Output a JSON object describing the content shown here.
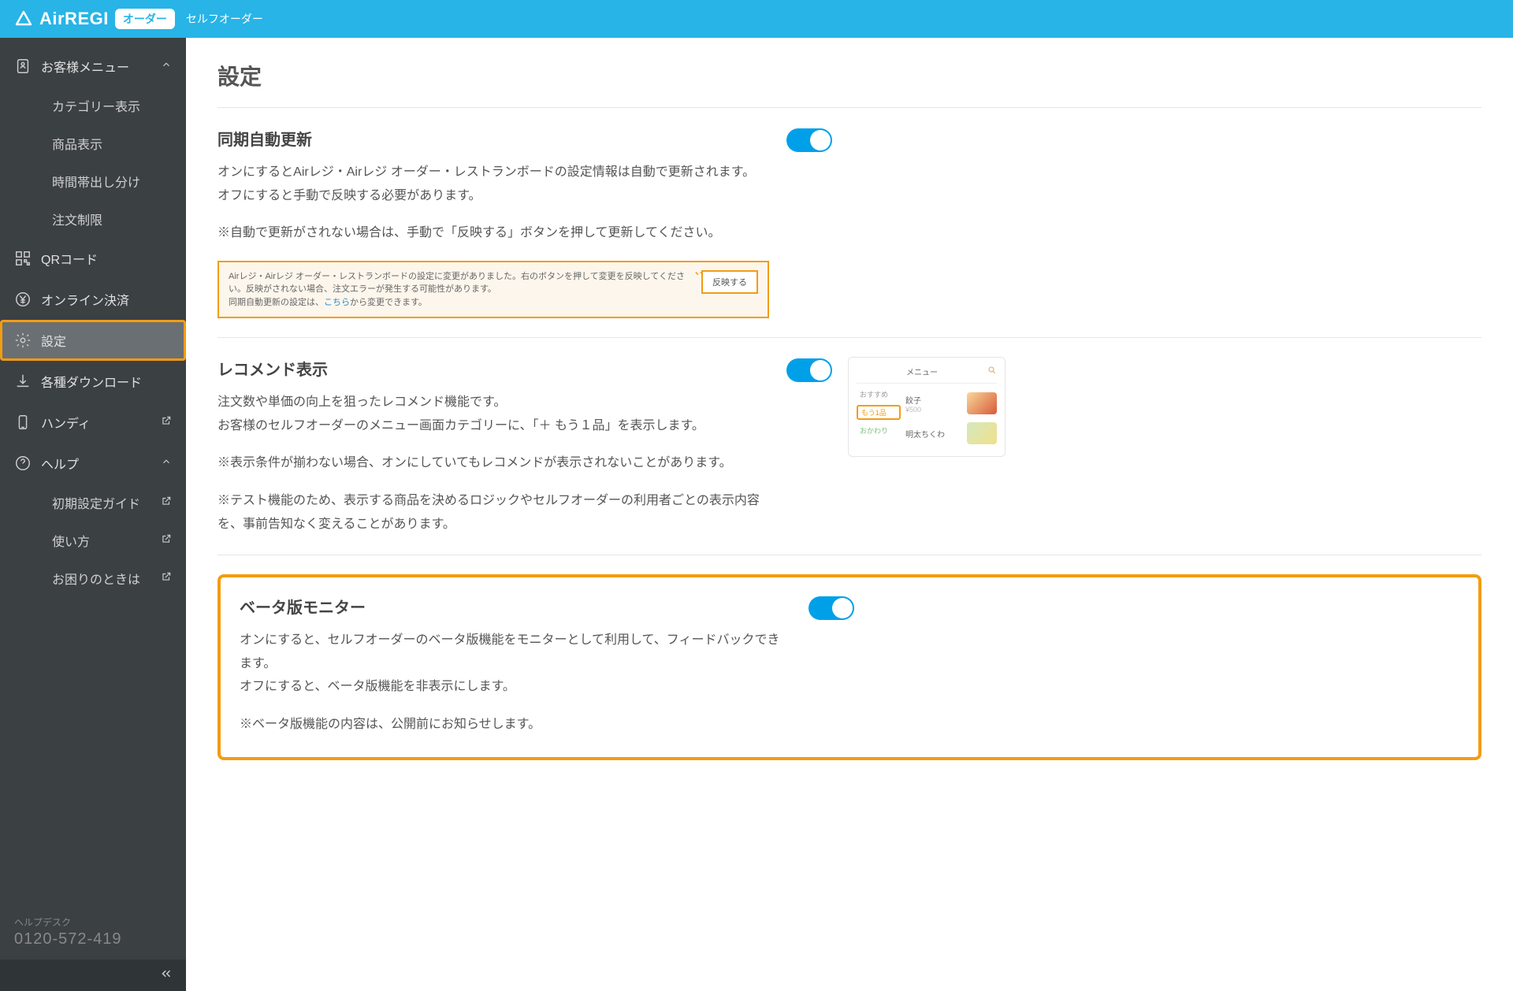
{
  "header": {
    "logo_text": "AirREGI",
    "logo_badge": "オーダー",
    "logo_sub": "セルフオーダー"
  },
  "sidebar": {
    "customer_menu_label": "お客様メニュー",
    "customer_sub": [
      "カテゴリー表示",
      "商品表示",
      "時間帯出し分け",
      "注文制限"
    ],
    "qr_label": "QRコード",
    "online_pay_label": "オンライン決済",
    "settings_label": "設定",
    "downloads_label": "各種ダウンロード",
    "handy_label": "ハンディ",
    "help_label": "ヘルプ",
    "help_sub": [
      "初期設定ガイド",
      "使い方",
      "お困りのときは"
    ],
    "helpdesk_label": "ヘルプデスク",
    "helpdesk_number": "0120-572-419"
  },
  "page": {
    "title": "設定"
  },
  "sync": {
    "title": "同期自動更新",
    "desc": "オンにするとAirレジ・Airレジ オーダー・レストランボードの設定情報は自動で更新されます。\nオフにすると手動で反映する必要があります。",
    "note": "※自動で更新がされない場合は、手動で「反映する」ボタンを押して更新してください。",
    "info_line1": "Airレジ・Airレジ オーダー・レストランボードの設定に変更がありました。右のボタンを押して変更を反映してください。反映がされない場合、注文エラーが発生する可能性があります。",
    "info_line2_pre": "同期自動更新の設定は、",
    "info_link": "こちら",
    "info_line2_post": "から変更できます。",
    "info_button": "反映する"
  },
  "recommend": {
    "title": "レコメンド表示",
    "desc": "注文数や単価の向上を狙ったレコメンド機能です。\nお客様のセルフオーダーのメニュー画面カテゴリーに、「＋ もう１品」を表示します。",
    "note1": "※表示条件が揃わない場合、オンにしていてもレコメンドが表示されないことがあります。",
    "note2": "※テスト機能のため、表示する商品を決めるロジックやセルフオーダーの利用者ごとの表示内容を、事前告知なく変えることがあります。",
    "preview": {
      "top_title": "メニュー",
      "tag_osusume": "おすすめ",
      "tag_mou1": "もう1品",
      "tag_okawari": "おかわり",
      "item1": "餃子",
      "item1_price": "¥500",
      "item2": "明太ちくわ"
    }
  },
  "beta": {
    "title": "ベータ版モニター",
    "desc": "オンにすると、セルフオーダーのベータ版機能をモニターとして利用して、フィードバックできます。\nオフにすると、ベータ版機能を非表示にします。",
    "note": "※ベータ版機能の内容は、公開前にお知らせします。"
  }
}
